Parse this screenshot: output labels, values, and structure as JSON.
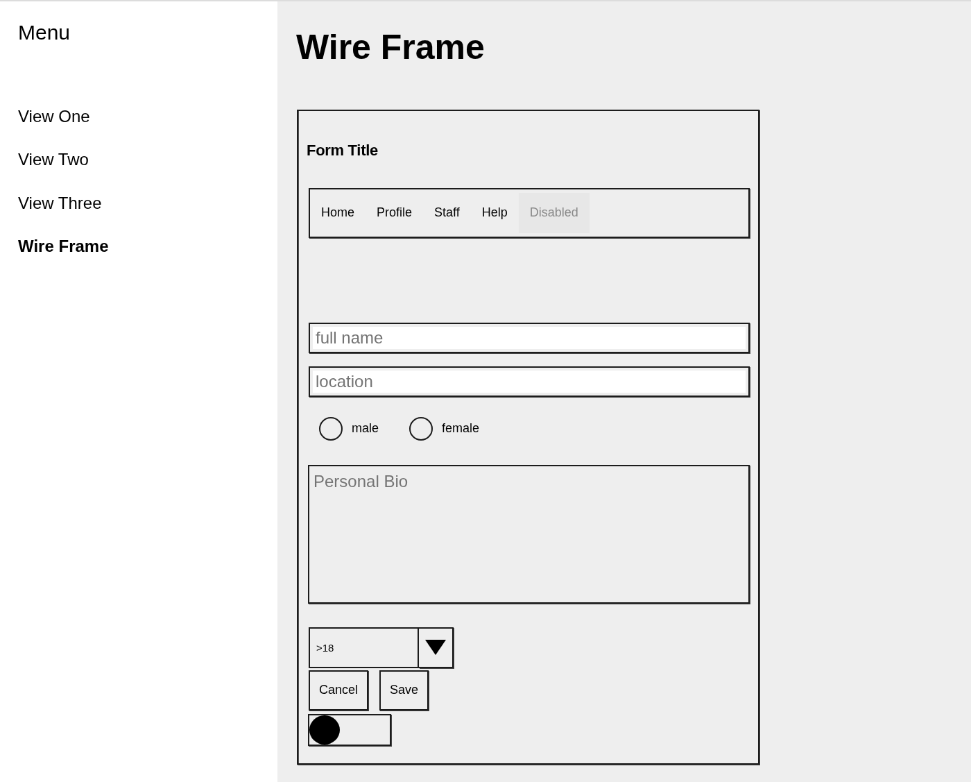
{
  "sidebar": {
    "title": "Menu",
    "items": [
      {
        "label": "View One",
        "selected": false
      },
      {
        "label": "View Two",
        "selected": false
      },
      {
        "label": "View Three",
        "selected": false
      },
      {
        "label": "Wire Frame",
        "selected": true
      }
    ]
  },
  "page_title": "Wire Frame",
  "form": {
    "title": "Form Title",
    "tabs": [
      {
        "label": "Home",
        "selected": false,
        "disabled": false
      },
      {
        "label": "Profile",
        "selected": false,
        "disabled": false
      },
      {
        "label": "Staff",
        "selected": false,
        "disabled": false
      },
      {
        "label": "Help",
        "selected": false,
        "disabled": false
      },
      {
        "label": "Disabled",
        "selected": false,
        "disabled": true
      }
    ],
    "fields": [
      {
        "placeholder": "full name"
      },
      {
        "placeholder": "location"
      }
    ],
    "radios": [
      {
        "label": "male",
        "selected": false
      },
      {
        "label": "female",
        "selected": false
      }
    ],
    "bio": {
      "placeholder": "Personal Bio"
    },
    "select": {
      "value": ">18"
    },
    "buttons": [
      {
        "label": "Cancel"
      },
      {
        "label": "Save"
      }
    ],
    "toggle": {
      "on": false
    }
  }
}
